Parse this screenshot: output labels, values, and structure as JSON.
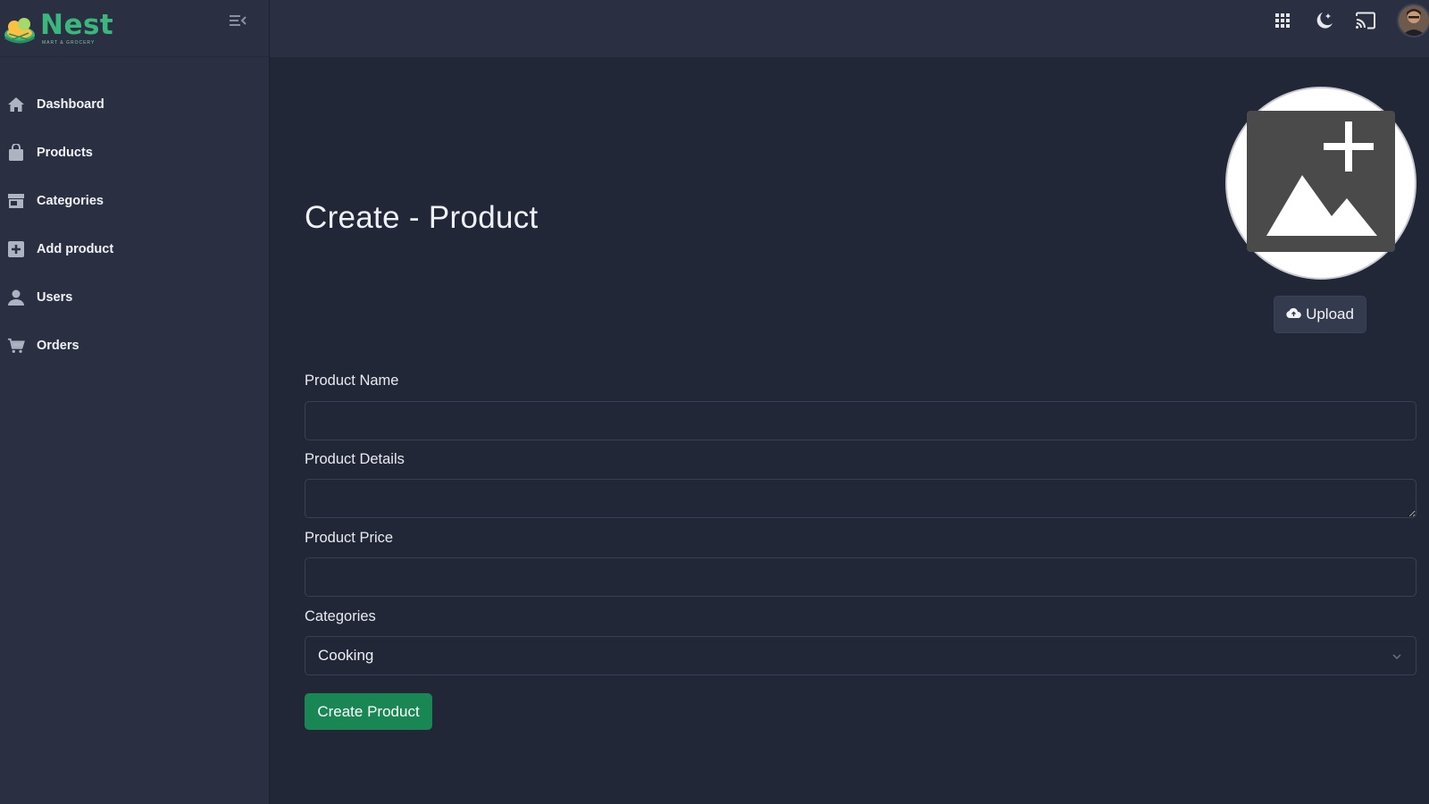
{
  "brand": {
    "name": "Nest",
    "tagline": "MART & GROCERY"
  },
  "sidebar": {
    "items": [
      {
        "label": "Dashboard",
        "icon": "home-icon"
      },
      {
        "label": "Products",
        "icon": "shopping-bag-icon"
      },
      {
        "label": "Categories",
        "icon": "store-icon"
      },
      {
        "label": "Add product",
        "icon": "plus-square-icon"
      },
      {
        "label": "Users",
        "icon": "user-icon"
      },
      {
        "label": "Orders",
        "icon": "cart-icon"
      }
    ]
  },
  "topbar": {
    "icons": [
      "grid-apps-icon",
      "moon-icon",
      "cast-icon",
      "avatar"
    ]
  },
  "page": {
    "title": "Create - Product"
  },
  "image_upload": {
    "icon": "add-image-icon",
    "button_label": "Upload",
    "button_icon": "cloud-upload-icon"
  },
  "form": {
    "product_name": {
      "label": "Product Name",
      "value": ""
    },
    "product_details": {
      "label": "Product Details",
      "value": ""
    },
    "product_price": {
      "label": "Product Price",
      "value": ""
    },
    "categories": {
      "label": "Categories",
      "selected": "Cooking"
    },
    "submit_label": "Create Product"
  },
  "colors": {
    "background": "#222738",
    "sidebar": "#2a3042",
    "brand_green": "#3bb77e",
    "submit_button": "#198754"
  }
}
